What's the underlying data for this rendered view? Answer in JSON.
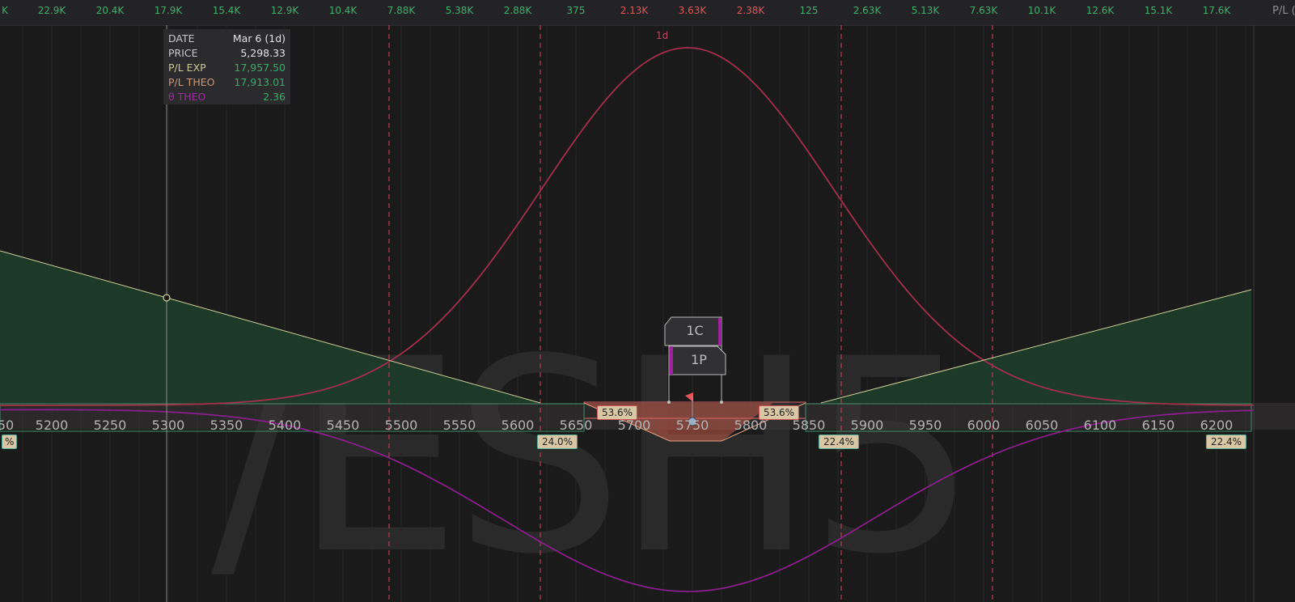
{
  "top_values": [
    {
      "text": "K",
      "color": "green"
    },
    {
      "text": "22.9K",
      "color": "green"
    },
    {
      "text": "20.4K",
      "color": "green"
    },
    {
      "text": "17.9K",
      "color": "green"
    },
    {
      "text": "15.4K",
      "color": "green"
    },
    {
      "text": "12.9K",
      "color": "green"
    },
    {
      "text": "10.4K",
      "color": "green"
    },
    {
      "text": "7.88K",
      "color": "green"
    },
    {
      "text": "5.38K",
      "color": "green"
    },
    {
      "text": "2.88K",
      "color": "green"
    },
    {
      "text": "375",
      "color": "green"
    },
    {
      "text": "2.13K",
      "color": "red"
    },
    {
      "text": "3.63K",
      "color": "red"
    },
    {
      "text": "2.38K",
      "color": "red"
    },
    {
      "text": "125",
      "color": "green"
    },
    {
      "text": "2.63K",
      "color": "green"
    },
    {
      "text": "5.13K",
      "color": "green"
    },
    {
      "text": "7.63K",
      "color": "green"
    },
    {
      "text": "10.1K",
      "color": "green"
    },
    {
      "text": "12.6K",
      "color": "green"
    },
    {
      "text": "15.1K",
      "color": "green"
    },
    {
      "text": "17.6K",
      "color": "green"
    }
  ],
  "pl_label": "P/L (",
  "watermark": "/ESH5",
  "curve_label": "1d",
  "x_ticks": [
    "50",
    "5200",
    "5250",
    "5300",
    "5350",
    "5400",
    "5450",
    "5500",
    "5550",
    "5600",
    "5650",
    "5700",
    "5750",
    "5800",
    "5850",
    "5900",
    "5950",
    "6000",
    "6050",
    "6100",
    "6150",
    "6200"
  ],
  "infobox": {
    "date_label": "DATE",
    "date_value": "Mar 6 (1d)",
    "price_label": "PRICE",
    "price_value": "5,298.33",
    "plexp_label": "P/L EXP",
    "plexp_value": "17,957.50",
    "pltheo_label": "P/L THEO",
    "pltheo_value": "17,913.01",
    "theta_label": "θ THEO",
    "theta_value": "2.36"
  },
  "probabilities": {
    "inner_left": "53.6%",
    "inner_right": "53.6%",
    "outer_left": "24.0%",
    "outer_right_1": "22.4%",
    "outer_right_2": "22.4%",
    "far_left": "%"
  },
  "legs": {
    "call": "1C",
    "put": "1P"
  },
  "colors": {
    "green": "#3fae6c",
    "red": "#e05555",
    "background": "#1a1a1b",
    "profit_fill": "#1d3a28",
    "loss_fill": "#c45b4a",
    "prob_curve": "#a2304b",
    "theta_curve": "#8a1e8a",
    "expiry_line": "#cfcf9a"
  }
}
